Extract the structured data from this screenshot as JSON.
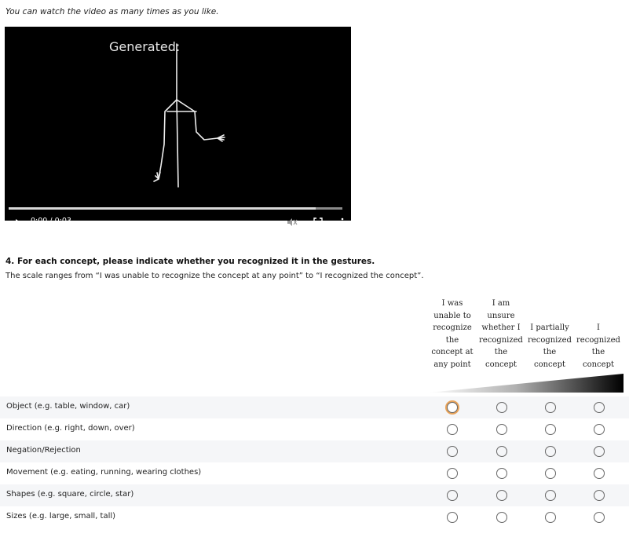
{
  "intro_text": "You can watch the video as many times as you like.",
  "video": {
    "caption": "Generated:",
    "time": "0:00 / 0:03",
    "progress": 0.92,
    "icons": [
      "play-icon",
      "mute-icon",
      "fullscreen-icon",
      "more-icon"
    ]
  },
  "question": {
    "title": "4. For each concept, please indicate whether you recognized it in the gestures.",
    "description": "The scale ranges from “I was unable to recognize the concept at any point” to “I recognized the concept”."
  },
  "scale": {
    "columns": [
      [
        "I was",
        "unable to",
        "recognize",
        "the",
        "concept at",
        "any point"
      ],
      [
        "I am",
        "unsure",
        "whether I",
        "recognized",
        "the",
        "concept"
      ],
      [
        "",
        "",
        "I partially",
        "recognized",
        "the",
        "concept"
      ],
      [
        "",
        "",
        "I",
        "recognized",
        "the",
        "concept"
      ]
    ]
  },
  "rows": [
    {
      "label": "Object (e.g. table, window, car)",
      "focused_column": 0
    },
    {
      "label": "Direction (e.g. right, down, over)"
    },
    {
      "label": "Negation/Rejection"
    },
    {
      "label": "Movement (e.g. eating, running, wearing clothes)"
    },
    {
      "label": "Shapes (e.g. square, circle, star)"
    },
    {
      "label": "Sizes (e.g. large, small, tall)"
    }
  ],
  "colors": {
    "focus_ring": "#e8a35a",
    "video_bg": "#000000"
  }
}
